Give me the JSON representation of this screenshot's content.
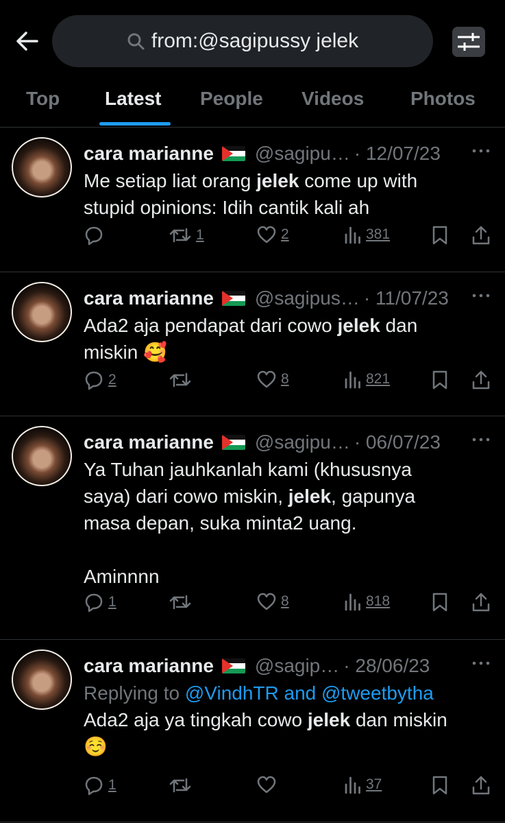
{
  "search": {
    "query": "from:@sagipussy jelek"
  },
  "tabs": [
    {
      "label": "Top"
    },
    {
      "label": "Latest"
    },
    {
      "label": "People"
    },
    {
      "label": "Videos"
    },
    {
      "label": "Photos"
    }
  ],
  "active_tab": "Latest",
  "tweets": [
    {
      "name": "cara marianne",
      "handle": "@sagipu…",
      "date": "· 12/07/23",
      "text_parts": [
        "Me setiap liat orang ",
        "jelek",
        " come up with\nstupid opinions: Idih cantik kali ah"
      ],
      "replies": "",
      "retweets": "1",
      "likes": "2",
      "views": "381"
    },
    {
      "name": "cara marianne",
      "handle": "@sagipus…",
      "date": "· 11/07/23",
      "text_parts": [
        "Ada2 aja pendapat dari cowo ",
        "jelek",
        " dan\nmiskin "
      ],
      "emoji": "🥰",
      "replies": "2",
      "retweets": "",
      "likes": "8",
      "views": "821"
    },
    {
      "name": "cara marianne",
      "handle": "@sagipu…",
      "date": "· 06/07/23",
      "text_parts": [
        "Ya Tuhan jauhkanlah kami (khususnya\nsaya) dari cowo miskin, ",
        "jelek",
        ", gapunya\nmasa depan, suka minta2 uang.\n\nAminnnn"
      ],
      "replies": "1",
      "retweets": "",
      "likes": "8",
      "views": "818"
    },
    {
      "name": "cara marianne",
      "handle": "@sagip…",
      "date": "· 28/06/23",
      "replying_prefix": "Replying to ",
      "replying_to": "@VindhTR and @tweetbytha",
      "text_parts": [
        "Ada2 aja ya tingkah cowo ",
        "jelek",
        " dan miskin\n"
      ],
      "emoji": "☺️",
      "replies": "1",
      "retweets": "",
      "likes": "",
      "views": "37"
    }
  ],
  "icons": {
    "back": "arrow-left-icon",
    "search": "search-icon",
    "filter": "filter-sliders-icon",
    "more": "more-dots-icon",
    "reply": "reply-icon",
    "retweet": "retweet-icon",
    "like": "heart-icon",
    "views": "views-icon",
    "bookmark": "bookmark-icon",
    "share": "share-icon"
  },
  "colors": {
    "accent": "#1d9bf0",
    "muted": "#71767b",
    "background": "#000000"
  }
}
